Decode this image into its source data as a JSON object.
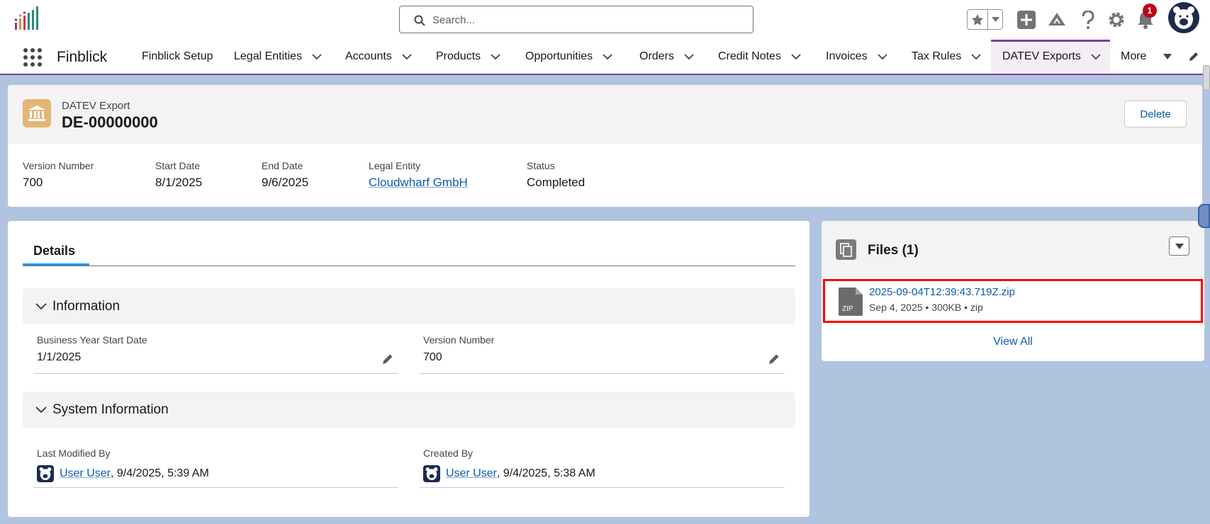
{
  "app": {
    "name": "Finblick"
  },
  "search": {
    "placeholder": "Search..."
  },
  "header": {
    "notification_count": "1"
  },
  "nav": {
    "items": [
      {
        "label": "Finblick Setup"
      },
      {
        "label": "Legal Entities"
      },
      {
        "label": "Accounts"
      },
      {
        "label": "Products"
      },
      {
        "label": "Opportunities"
      },
      {
        "label": "Orders"
      },
      {
        "label": "Credit Notes"
      },
      {
        "label": "Invoices"
      },
      {
        "label": "Tax Rules"
      },
      {
        "label": "DATEV Exports"
      },
      {
        "label": "More"
      }
    ]
  },
  "record": {
    "type": "DATEV Export",
    "title": "DE-00000000",
    "delete_label": "Delete",
    "fields": [
      {
        "label": "Version Number",
        "value": "700"
      },
      {
        "label": "Start Date",
        "value": "8/1/2025"
      },
      {
        "label": "End Date",
        "value": "9/6/2025"
      },
      {
        "label": "Legal Entity",
        "value": "Cloudwharf GmbH"
      },
      {
        "label": "Status",
        "value": "Completed"
      }
    ]
  },
  "details": {
    "tab_label": "Details",
    "information": {
      "title": "Information",
      "business_year_label": "Business Year Start Date",
      "business_year_value": "1/1/2025",
      "version_label": "Version Number",
      "version_value": "700"
    },
    "system": {
      "title": "System Information",
      "modified_label": "Last Modified By",
      "modified_user": "User User",
      "modified_time": ", 9/4/2025, 5:39 AM",
      "created_label": "Created By",
      "created_user": "User User",
      "created_time": ", 9/4/2025, 5:38 AM"
    }
  },
  "files": {
    "title": "Files (1)",
    "file_name": "2025-09-04T12:39:43.719Z.zip",
    "file_meta": "Sep 4, 2025 • 300KB • zip",
    "file_type_label": "ZIP",
    "view_all": "View All"
  },
  "colors": {
    "brand": "#7f3f98",
    "link": "#0b5cab",
    "record_icon": "#e3b677",
    "highlight": "#ff0000"
  }
}
